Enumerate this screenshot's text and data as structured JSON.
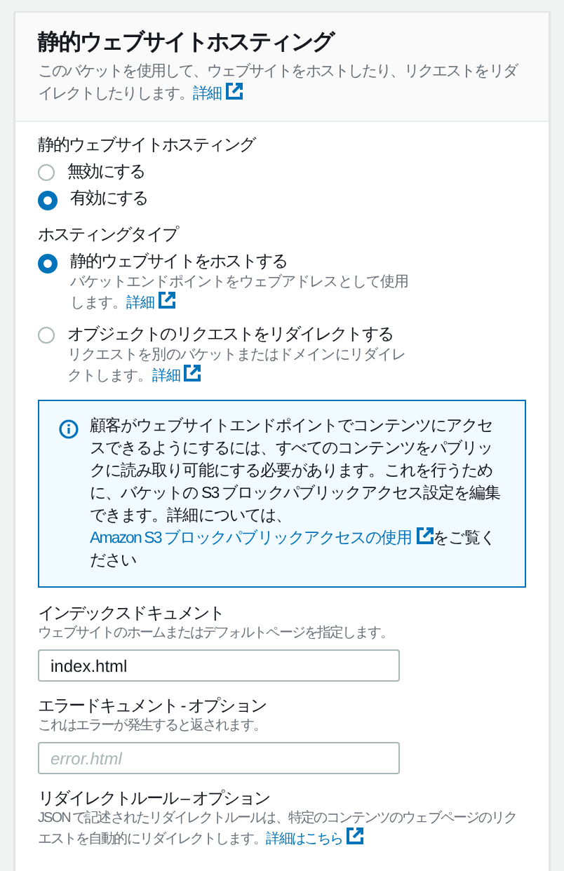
{
  "header": {
    "title": "静的ウェブサイトホスティング",
    "description": "このバケットを使用して、ウェブサイトをホストしたり、リクエストをリダイレクトしたりします。",
    "link": "詳細"
  },
  "hosting": {
    "label": "静的ウェブサイトホスティング",
    "options": [
      {
        "label": "無効にする",
        "selected": false
      },
      {
        "label": "有効にする",
        "selected": true
      }
    ]
  },
  "hosting_type": {
    "label": "ホスティングタイプ",
    "options": [
      {
        "label": "静的ウェブサイトをホストする",
        "description": "バケットエンドポイントをウェブアドレスとして使用します。",
        "link": "詳細",
        "selected": true
      },
      {
        "label": "オブジェクトのリクエストをリダイレクトする",
        "description": "リクエストを別のバケットまたはドメインにリダイレクトします。",
        "link": "詳細",
        "selected": false
      }
    ]
  },
  "info": {
    "text_before": "顧客がウェブサイトエンドポイントでコンテンツにアクセスできるようにするには、すべてのコンテンツをパブリックに読み取り可能にする必要があります。これを行うために、バケットの S3 ブロックパブリックアクセス設定を編集できます。詳細については、",
    "link": "Amazon S3 ブロックパブリックアクセスの使用",
    "text_after": "をご覧ください"
  },
  "index_document": {
    "label": "インデックスドキュメント",
    "hint": "ウェブサイトのホームまたはデフォルトページを指定します。",
    "value": "index.html"
  },
  "error_document": {
    "label": "エラードキュメント - オプション",
    "hint": "これはエラーが発生すると返されます。",
    "placeholder": "error.html"
  },
  "redirect_rules": {
    "label": "リダイレクトルール – オプション",
    "description": "JSON で記述されたリダイレクトルールは、特定のコンテンツのウェブページのリクエストを自動的にリダイレクトします。",
    "link": "詳細はこちら"
  }
}
